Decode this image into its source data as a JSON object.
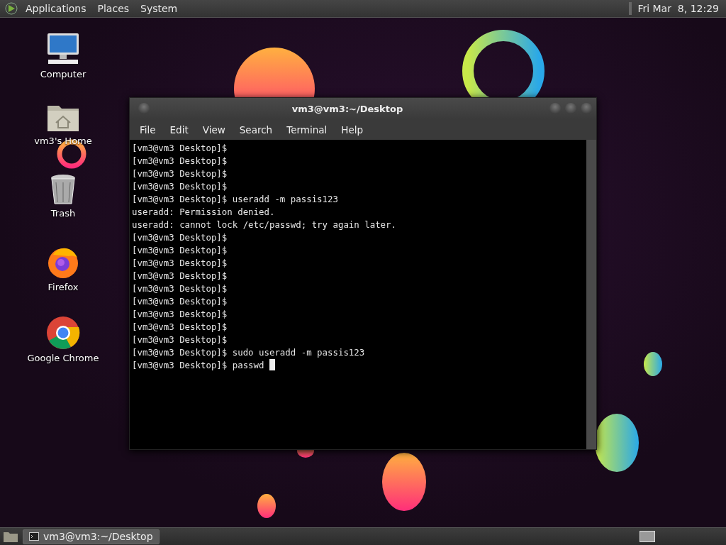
{
  "top_panel": {
    "menus": [
      "Applications",
      "Places",
      "System"
    ],
    "clock": "Fri Mar  8, 12:29"
  },
  "desktop_icons": [
    {
      "kind": "computer",
      "label": "Computer"
    },
    {
      "kind": "home",
      "label": "vm3's Home"
    },
    {
      "kind": "trash",
      "label": "Trash"
    },
    {
      "kind": "firefox",
      "label": "Firefox"
    },
    {
      "kind": "chrome",
      "label": "Google Chrome"
    }
  ],
  "terminal": {
    "title": "vm3@vm3:~/Desktop",
    "menu": [
      "File",
      "Edit",
      "View",
      "Search",
      "Terminal",
      "Help"
    ],
    "lines": [
      "[vm3@vm3 Desktop]$",
      "[vm3@vm3 Desktop]$",
      "[vm3@vm3 Desktop]$",
      "[vm3@vm3 Desktop]$",
      "[vm3@vm3 Desktop]$ useradd -m passis123",
      "useradd: Permission denied.",
      "useradd: cannot lock /etc/passwd; try again later.",
      "[vm3@vm3 Desktop]$",
      "[vm3@vm3 Desktop]$",
      "[vm3@vm3 Desktop]$",
      "[vm3@vm3 Desktop]$",
      "[vm3@vm3 Desktop]$",
      "[vm3@vm3 Desktop]$",
      "[vm3@vm3 Desktop]$",
      "[vm3@vm3 Desktop]$",
      "[vm3@vm3 Desktop]$",
      "[vm3@vm3 Desktop]$ sudo useradd -m passis123",
      "[vm3@vm3 Desktop]$ passwd "
    ]
  },
  "taskbar": {
    "tasks": [
      {
        "label": "vm3@vm3:~/Desktop",
        "selected": true
      }
    ]
  }
}
